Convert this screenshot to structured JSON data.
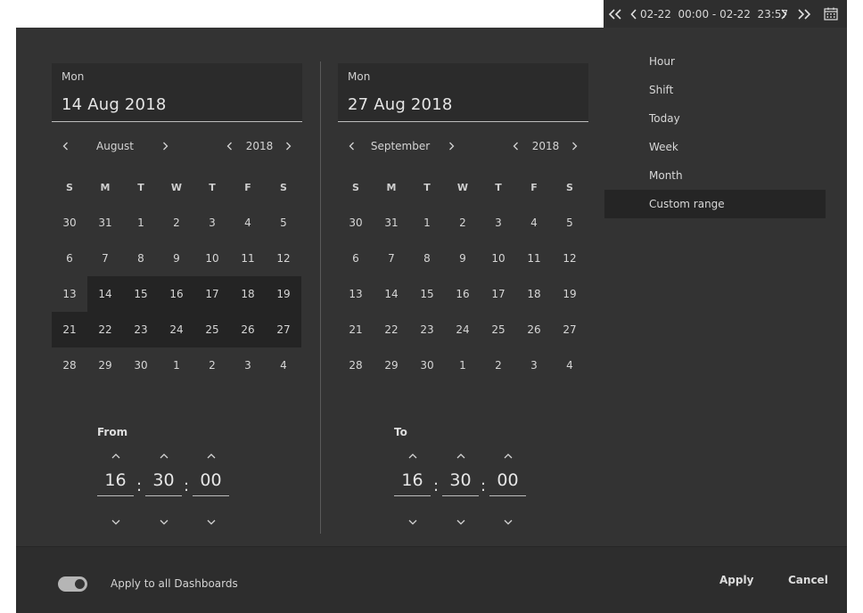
{
  "topbar": {
    "range_start": "02-22  00:00",
    "range_sep": " - ",
    "range_end": "02-22  23:57",
    "icons": [
      "double-chevron-left-icon",
      "chevron-left-icon",
      "chevron-right-icon",
      "double-chevron-right-icon",
      "calendar-icon"
    ]
  },
  "from_calendar": {
    "day_of_week": "Mon",
    "date_value": "14 Aug 2018",
    "month": "August",
    "year": "2018",
    "weekday_headers": [
      "S",
      "M",
      "T",
      "W",
      "T",
      "F",
      "S"
    ],
    "weeks": [
      [
        "30",
        "31",
        "1",
        "2",
        "3",
        "4",
        "5"
      ],
      [
        "6",
        "7",
        "8",
        "9",
        "10",
        "11",
        "12"
      ],
      [
        "13",
        "14",
        "15",
        "16",
        "17",
        "18",
        "19"
      ],
      [
        "21",
        "22",
        "23",
        "24",
        "25",
        "26",
        "27"
      ],
      [
        "28",
        "29",
        "30",
        "1",
        "2",
        "3",
        "4"
      ]
    ]
  },
  "to_calendar": {
    "day_of_week": "Mon",
    "date_value": "27 Aug 2018",
    "month": "September",
    "year": "2018",
    "weekday_headers": [
      "S",
      "M",
      "T",
      "W",
      "T",
      "F",
      "S"
    ],
    "weeks": [
      [
        "30",
        "31",
        "1",
        "2",
        "3",
        "4",
        "5"
      ],
      [
        "6",
        "7",
        "8",
        "9",
        "10",
        "11",
        "12"
      ],
      [
        "13",
        "14",
        "15",
        "16",
        "17",
        "18",
        "19"
      ],
      [
        "21",
        "22",
        "23",
        "24",
        "25",
        "26",
        "27"
      ],
      [
        "28",
        "29",
        "30",
        "1",
        "2",
        "3",
        "4"
      ]
    ]
  },
  "from_time": {
    "label": "From",
    "hours": "16",
    "minutes": "30",
    "seconds": "00",
    "separator": ":"
  },
  "to_time": {
    "label": "To",
    "hours": "16",
    "minutes": "30",
    "seconds": "00",
    "separator": ":"
  },
  "range_menu": {
    "items": [
      "Hour",
      "Shift",
      "Today",
      "Week",
      "Month",
      "Custom range"
    ],
    "active_index": 5
  },
  "footer": {
    "toggle_label": "Apply to all Dashboards",
    "toggle_on": true,
    "apply_label": "Apply",
    "cancel_label": "Cancel"
  },
  "colors": {
    "panel_bg": "#333333",
    "field_bg": "#2b2b2b",
    "selected_bg": "#242424",
    "text": "#d6d6d6"
  }
}
